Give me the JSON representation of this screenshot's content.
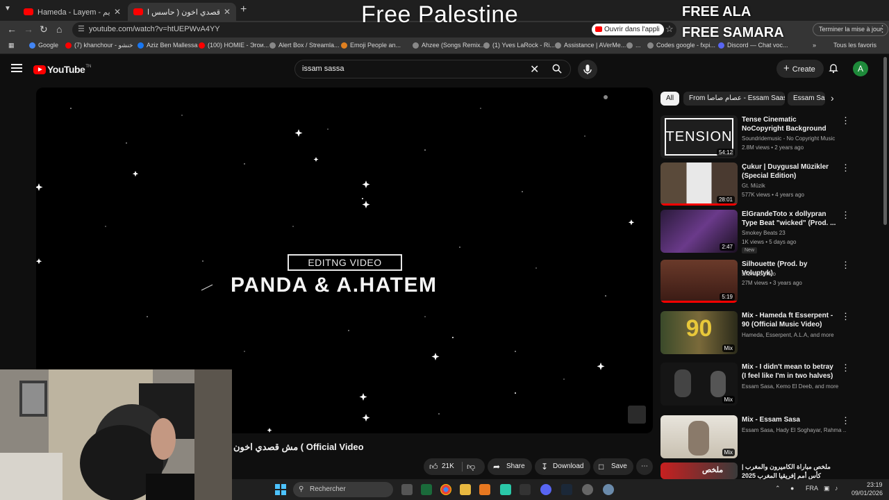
{
  "browser": {
    "tabs": [
      {
        "title": "Hameda - Layem - لايم (Officia",
        "active": false
      },
      {
        "title": "مش قصدي اخون ( حاسس ا...",
        "active": true
      }
    ],
    "url": "youtube.com/watch?v=htUEPWvA4YY",
    "open_in_app": "Ouvrir dans l'appli",
    "update_button": "Terminer la mise à jour",
    "bookmarks": [
      {
        "label": "Google",
        "color": "#4285f4"
      },
      {
        "label": "(7) khanchour - خنشو",
        "color": "#ff0000"
      },
      {
        "label": "Aziz Ben Mallessa",
        "color": "#1877f2"
      },
      {
        "label": "(100) HOMIE - Эгои...",
        "color": "#ff0000"
      },
      {
        "label": "Alert Box / Streamla...",
        "color": "#888888"
      },
      {
        "label": "Emoji People an...",
        "color": "#e08020"
      },
      {
        "label": "Ahzee (Songs Remix...",
        "color": "#888888"
      },
      {
        "label": "(1) Yves LaRock - Ri...",
        "color": "#888888"
      },
      {
        "label": "Assistance | AVerMe...",
        "color": "#888888"
      },
      {
        "label": "...",
        "color": "#888888"
      },
      {
        "label": "Codes google - fxpi...",
        "color": "#888888"
      },
      {
        "label": "Discord — Chat voc...",
        "color": "#5865f2"
      }
    ],
    "all_bookmarks": "Tous les favoris"
  },
  "overlay": {
    "title": "Free Palestine",
    "line1": "FREE ALA",
    "line2": "FREE SAMARA"
  },
  "youtube": {
    "logo_text": "YouTube",
    "logo_tn": "TN",
    "search_query": "issam sassa",
    "create_label": "Create",
    "avatar_letter": "A",
    "video": {
      "overlay_label": "EDITNG VIDEO",
      "overlay_title": "PANDA & A.HATEM",
      "title": "مش قصدي اخون ( Official Video",
      "likes": "21K",
      "share": "Share",
      "download": "Download",
      "save": "Save"
    },
    "chips": [
      {
        "label": "All",
        "active": true
      },
      {
        "label": "From عصام صاصا - Essam Saasa",
        "active": false
      },
      {
        "label": "Essam Sa",
        "active": false
      }
    ],
    "recommendations": [
      {
        "title": "Tense Cinematic NoCopyright Background Music Compilation",
        "channel": "Soundridemusic - No Copyright Music",
        "meta": "2.8M views • 2 years ago",
        "badge": "54:12",
        "thumb_text": "TENSION",
        "new": ""
      },
      {
        "title": "Çukur | Duygusal Müzikler (Special Edition)",
        "channel": "Gt. Müzik",
        "meta": "577K views • 4 years ago",
        "badge": "28:01",
        "thumb_text": "",
        "new": ""
      },
      {
        "title": "ElGrandeToto x dollypran Type Beat \"wicked\" (Prod. ...",
        "channel": "Smokey Beats 23",
        "meta": "1K views • 5 days ago",
        "badge": "2:47",
        "thumb_text": "",
        "new": "New"
      },
      {
        "title": "Silhouette (Prod. by Voluptyk)",
        "channel": "ElGrandeToto",
        "meta": "27M views • 3 years ago",
        "badge": "5:19",
        "thumb_text": "",
        "new": ""
      },
      {
        "title": "Mix - Hameda ft Esserpent - 90 (Official Music Video)",
        "channel": "Hameda, Esserpent, A.L.A, and more",
        "meta": "",
        "badge": "Mix",
        "thumb_text": "90",
        "new": ""
      },
      {
        "title": "Mix - I didn't mean to betray (I feel like I'm in two halves) ...",
        "channel": "Essam Sasa, Kemo El Deeb, and more",
        "meta": "",
        "badge": "Mix",
        "thumb_text": "",
        "new": ""
      },
      {
        "title": "Mix - Essam Sasa",
        "channel": "Essam Sasa, Hady El Soghayar, Rahma ...",
        "meta": "",
        "badge": "Mix",
        "thumb_text": "",
        "new": ""
      },
      {
        "title": "ملخص مباراة الكاميرون والمغرب | كأس أمم إفريقيا المغرب 2025",
        "channel": "",
        "meta": "",
        "badge": "",
        "thumb_text": "ملخص",
        "new": ""
      }
    ]
  },
  "taskbar": {
    "search_placeholder": "Rechercher",
    "language": "FRA",
    "time": "23:19",
    "date": "09/01/2026"
  }
}
